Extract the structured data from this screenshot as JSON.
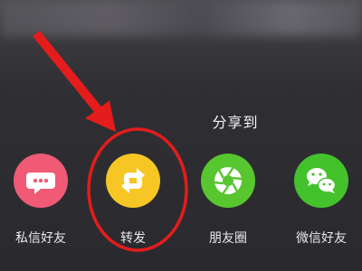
{
  "share_panel": {
    "title": "分享到",
    "items": [
      {
        "label": "私信好友",
        "icon": "chat-bubble-icon",
        "color": "#f05a74"
      },
      {
        "label": "转发",
        "icon": "repost-arrows-icon",
        "color": "#f6c624"
      },
      {
        "label": "朋友圈",
        "icon": "aperture-icon",
        "color": "#58c62f"
      },
      {
        "label": "微信好友",
        "icon": "wechat-icon",
        "color": "#44c22c"
      }
    ]
  },
  "annotation": {
    "color": "#e41c1c"
  }
}
